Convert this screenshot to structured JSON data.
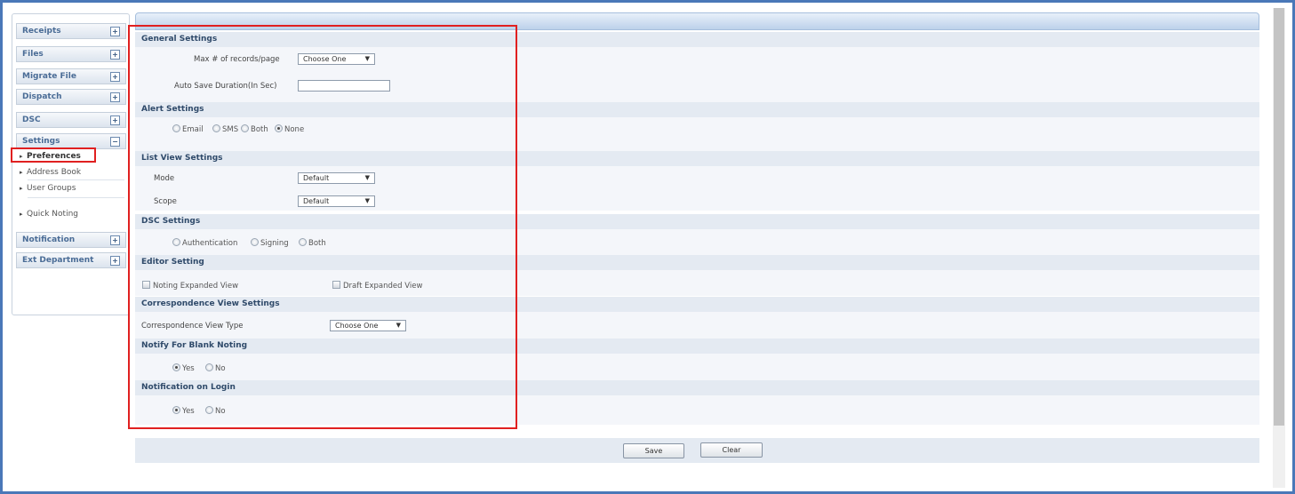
{
  "sidebar": {
    "menus": [
      {
        "label": "Receipts",
        "toggle": "+"
      },
      {
        "label": "Files",
        "toggle": "+"
      },
      {
        "label": "Migrate File",
        "toggle": "+"
      },
      {
        "label": "Dispatch",
        "toggle": "+"
      },
      {
        "label": "DSC",
        "toggle": "+"
      },
      {
        "label": "Settings",
        "toggle": "−"
      },
      {
        "label": "Notification",
        "toggle": "+"
      },
      {
        "label": "Ext Department",
        "toggle": "+"
      }
    ],
    "settings_items": [
      {
        "label": "Preferences",
        "selected": true
      },
      {
        "label": "Address Book"
      },
      {
        "label": "User Groups"
      },
      {
        "label": "Quick Noting"
      }
    ],
    "arrow_icon": "▸"
  },
  "general": {
    "title": "General Settings",
    "max_records_label": "Max # of records/page",
    "max_records_value": "Choose One",
    "auto_save_label": "Auto Save Duration(In Sec)",
    "auto_save_value": ""
  },
  "alert": {
    "title": "Alert Settings",
    "options": [
      "Email",
      "SMS",
      "Both",
      "None"
    ],
    "selected": "None"
  },
  "list_view": {
    "title": "List View Settings",
    "mode_label": "Mode",
    "mode_value": "Default",
    "scope_label": "Scope",
    "scope_value": "Default"
  },
  "dsc": {
    "title": "DSC Settings",
    "options": [
      "Authentication",
      "Signing",
      "Both"
    ]
  },
  "editor": {
    "title": "Editor Setting",
    "noting_label": "Noting Expanded View",
    "draft_label": "Draft Expanded View"
  },
  "correspondence": {
    "title": "Correspondence View Settings",
    "type_label": "Correspondence View Type",
    "type_value": "Choose One"
  },
  "blank_noting": {
    "title": "Notify For Blank Noting",
    "yes": "Yes",
    "no": "No",
    "selected": "Yes"
  },
  "login_notif": {
    "title": "Notification on Login",
    "yes": "Yes",
    "no": "No",
    "selected": "Yes"
  },
  "buttons": {
    "save": "Save",
    "clear": "Clear"
  },
  "dropdown_icon": "▼"
}
